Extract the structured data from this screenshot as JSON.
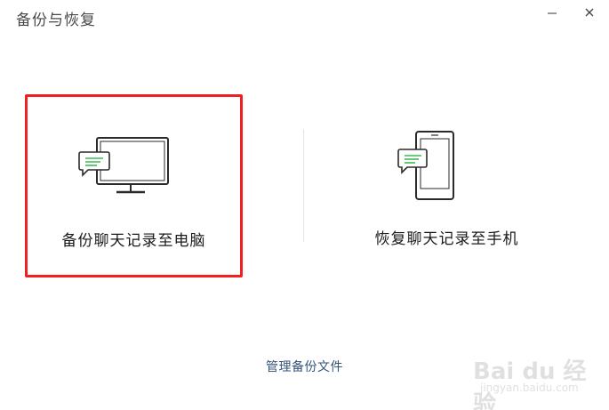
{
  "window": {
    "title": "备份与恢复",
    "minimize_icon": "minimize-icon",
    "close_icon": "close-icon"
  },
  "options": [
    {
      "label": "备份聊天记录至电脑",
      "icon": "computer-chat-icon",
      "selected": true
    },
    {
      "label": "恢复聊天记录至手机",
      "icon": "phone-chat-icon",
      "selected": false
    }
  ],
  "footer": {
    "manage_link": "管理备份文件"
  },
  "watermark": {
    "logo": "Bai du 经验",
    "url": "jingyan.baidu.com"
  },
  "colors": {
    "selection_border": "#f02020",
    "chat_bubble_lines": "#3dbb52",
    "link": "#35547a"
  }
}
